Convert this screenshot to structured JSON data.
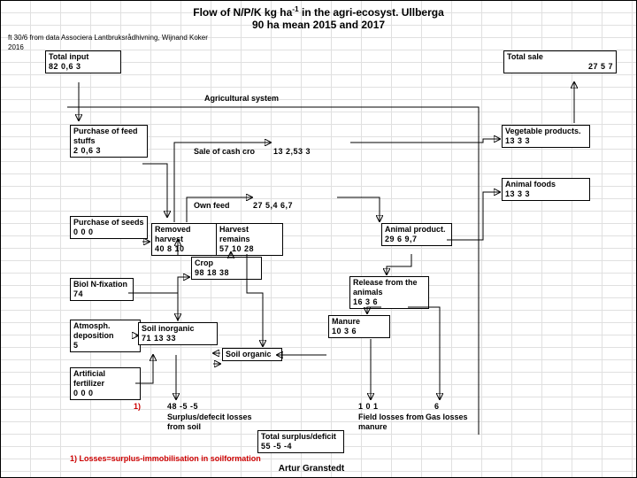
{
  "title1_a": "Flow of N/P/K kg ha",
  "title1_b": " in the agri-ecosyst. Ullberga",
  "title2": "90 ha mean 2015 and 2017",
  "source": "ft 30/6 from  data Associera Lantbruksrådhivning, Wijnand Koker",
  "year": "2016",
  "section": "Agricultural system",
  "author": "Artur Granstedt",
  "footnote": "1) Losses=surplus-immobilisation in soilformation",
  "nodes": {
    "total_input": {
      "label": "Total input",
      "vals": "82  0,6     3"
    },
    "total_sale": {
      "label": "Total sale",
      "vals": "27       5      7"
    },
    "purchase_feed": {
      "label": "Purchase of feed stuffs",
      "vals": "2  0,6    3"
    },
    "sale_cash_crop": {
      "label": "Sale of cash cro",
      "vals": "13   2,53      3"
    },
    "veg_products": {
      "label": "Vegetable products.",
      "vals": "13        3       3"
    },
    "own_feed": {
      "label": "Own feed",
      "vals": "27   5,4     6,7"
    },
    "animal_foods": {
      "label": "Animal foods",
      "vals": "13        3       3"
    },
    "purchase_seeds": {
      "label": "Purchase of seeds",
      "vals": "0     0    0"
    },
    "removed_harvest": {
      "label": "Removed harvest",
      "vals": "40     8    10"
    },
    "harvest_remains": {
      "label": "Harvest remains",
      "vals": "57   10  28"
    },
    "animal_product": {
      "label": "Animal product.",
      "vals": "29    6    9,7"
    },
    "crop": {
      "label": "Crop",
      "vals": "98    18   38"
    },
    "biol_n": {
      "label": "Biol N-fixation",
      "vals": "74"
    },
    "release": {
      "label": "Release from the animals",
      "vals": "16    3     6"
    },
    "atm_dep": {
      "label": "Atmosph. deposition",
      "vals": "5"
    },
    "soil_inorg": {
      "label": "Soil inorganic",
      "vals": "71    13    33"
    },
    "manure": {
      "label": "Manure",
      "vals": "10  3   6"
    },
    "soil_org": {
      "label": "Soil organic",
      "vals": ""
    },
    "artificial": {
      "label": "Artificial fertilizer",
      "vals": "0     0    0"
    },
    "surplus_soil": {
      "label": "Surplus/defecit losses from soil",
      "note": "1)",
      "vals": "48    -5   -5"
    },
    "field_losses": {
      "label": "Field losses from manure",
      "vals": "1    0   1"
    },
    "gas_losses": {
      "label": "Gas losses",
      "vals": "6"
    },
    "total_surplus": {
      "label": "Total surplus/deficit",
      "vals": "55    -5   -4"
    }
  }
}
